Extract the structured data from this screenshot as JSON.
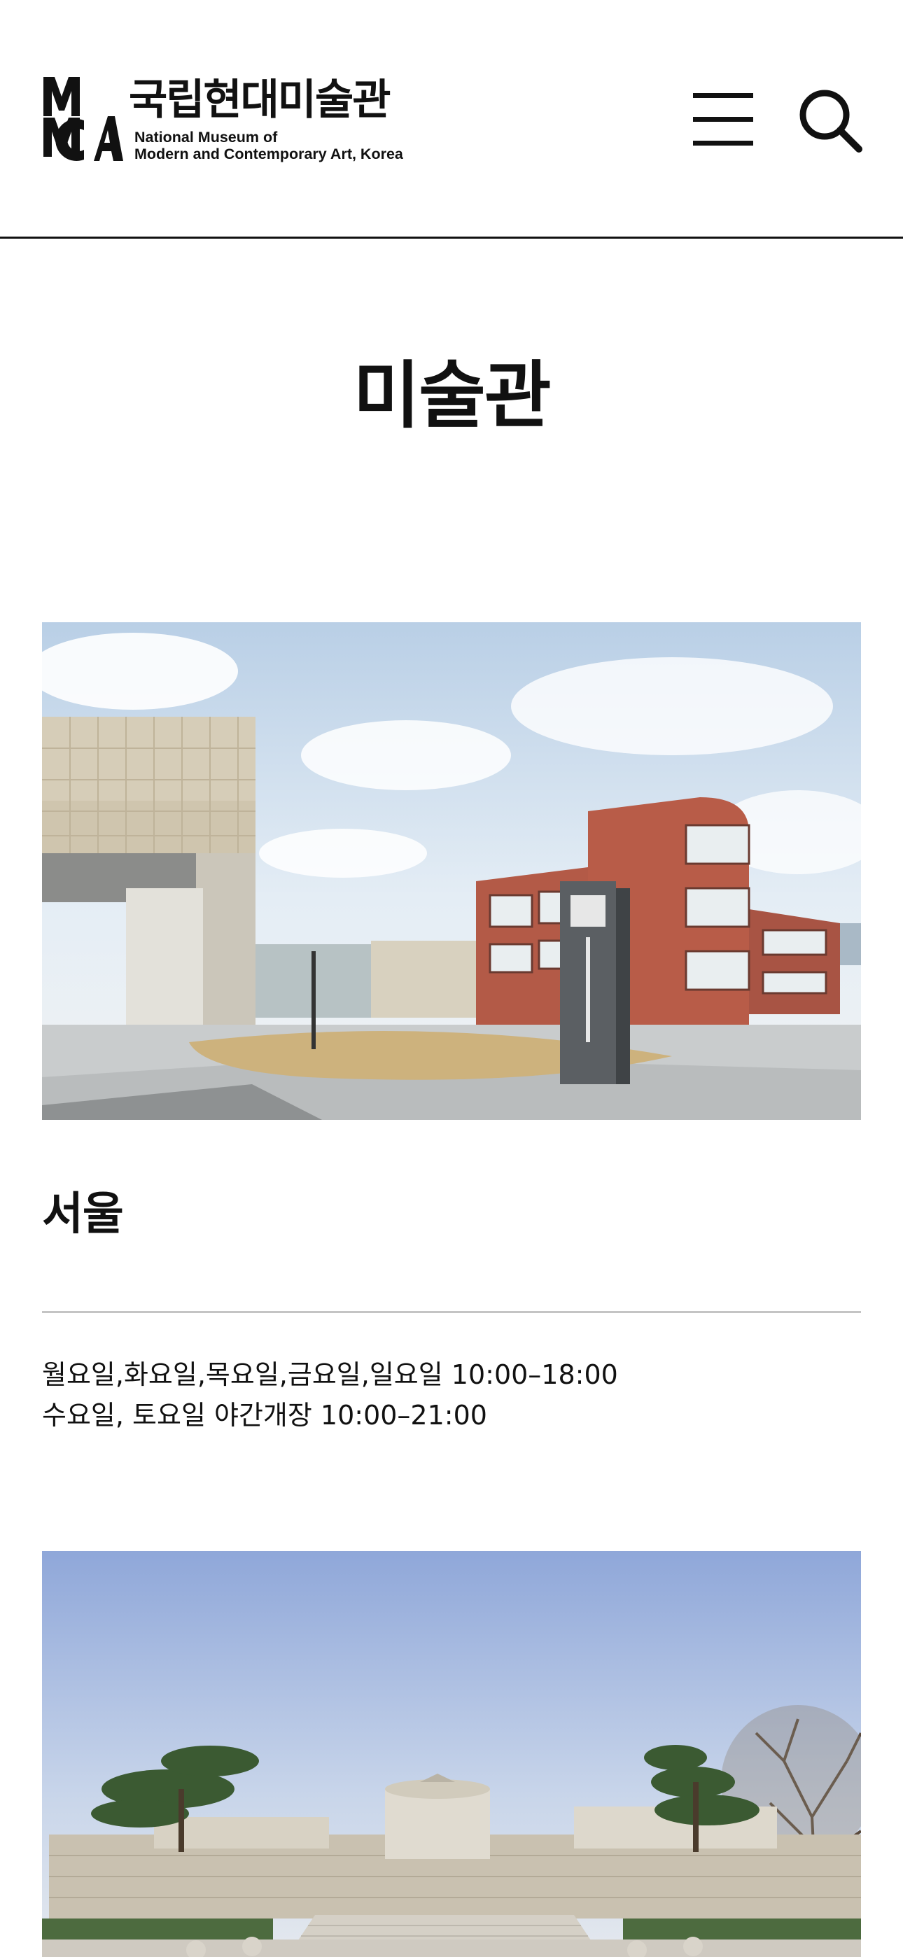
{
  "header": {
    "logo_korean": "국립현대미술관",
    "logo_english_line1": "National Museum of",
    "logo_english_line2": "Modern and Contemporary Art, Korea",
    "menu_icon": "hamburger-menu-icon",
    "search_icon": "search-icon"
  },
  "page": {
    "title": "미술관"
  },
  "branches": [
    {
      "name": "서울",
      "hours_line1": "월요일,화요일,목요일,금요일,일요일 10:00–18:00",
      "hours_line2": "수요일, 토요일 야간개장 10:00–21:00"
    }
  ],
  "colors": {
    "text": "#111111",
    "divider": "#c4c4c4",
    "background": "#ffffff"
  }
}
